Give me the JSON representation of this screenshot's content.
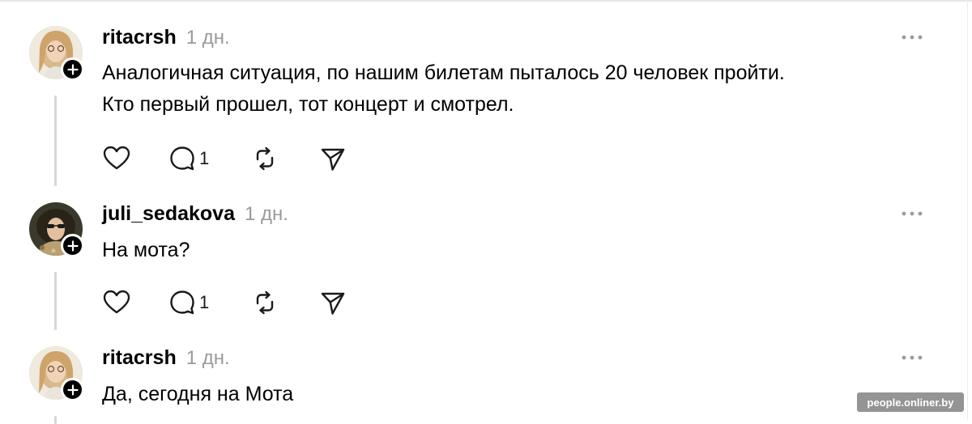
{
  "posts": [
    {
      "username": "ritacrsh",
      "time": "1 дн.",
      "lines": [
        "Аналогичная ситуация, по нашим билетам пыталось 20 человек пройти.",
        "Кто первый прошел, тот концерт и смотрел."
      ],
      "reply_count": "1"
    },
    {
      "username": "juli_sedakova",
      "time": "1 дн.",
      "lines": [
        "На мота?"
      ],
      "reply_count": "1"
    },
    {
      "username": "ritacrsh",
      "time": "1 дн.",
      "lines": [
        "Да, сегодня на Мота"
      ]
    }
  ],
  "icons": {
    "like": "heart-icon",
    "reply": "comment-bubble-icon",
    "repost": "repost-arrows-icon",
    "share": "paper-plane-icon",
    "more": "more-dots-icon",
    "follow": "plus-icon"
  },
  "watermark": "people.onliner.by"
}
